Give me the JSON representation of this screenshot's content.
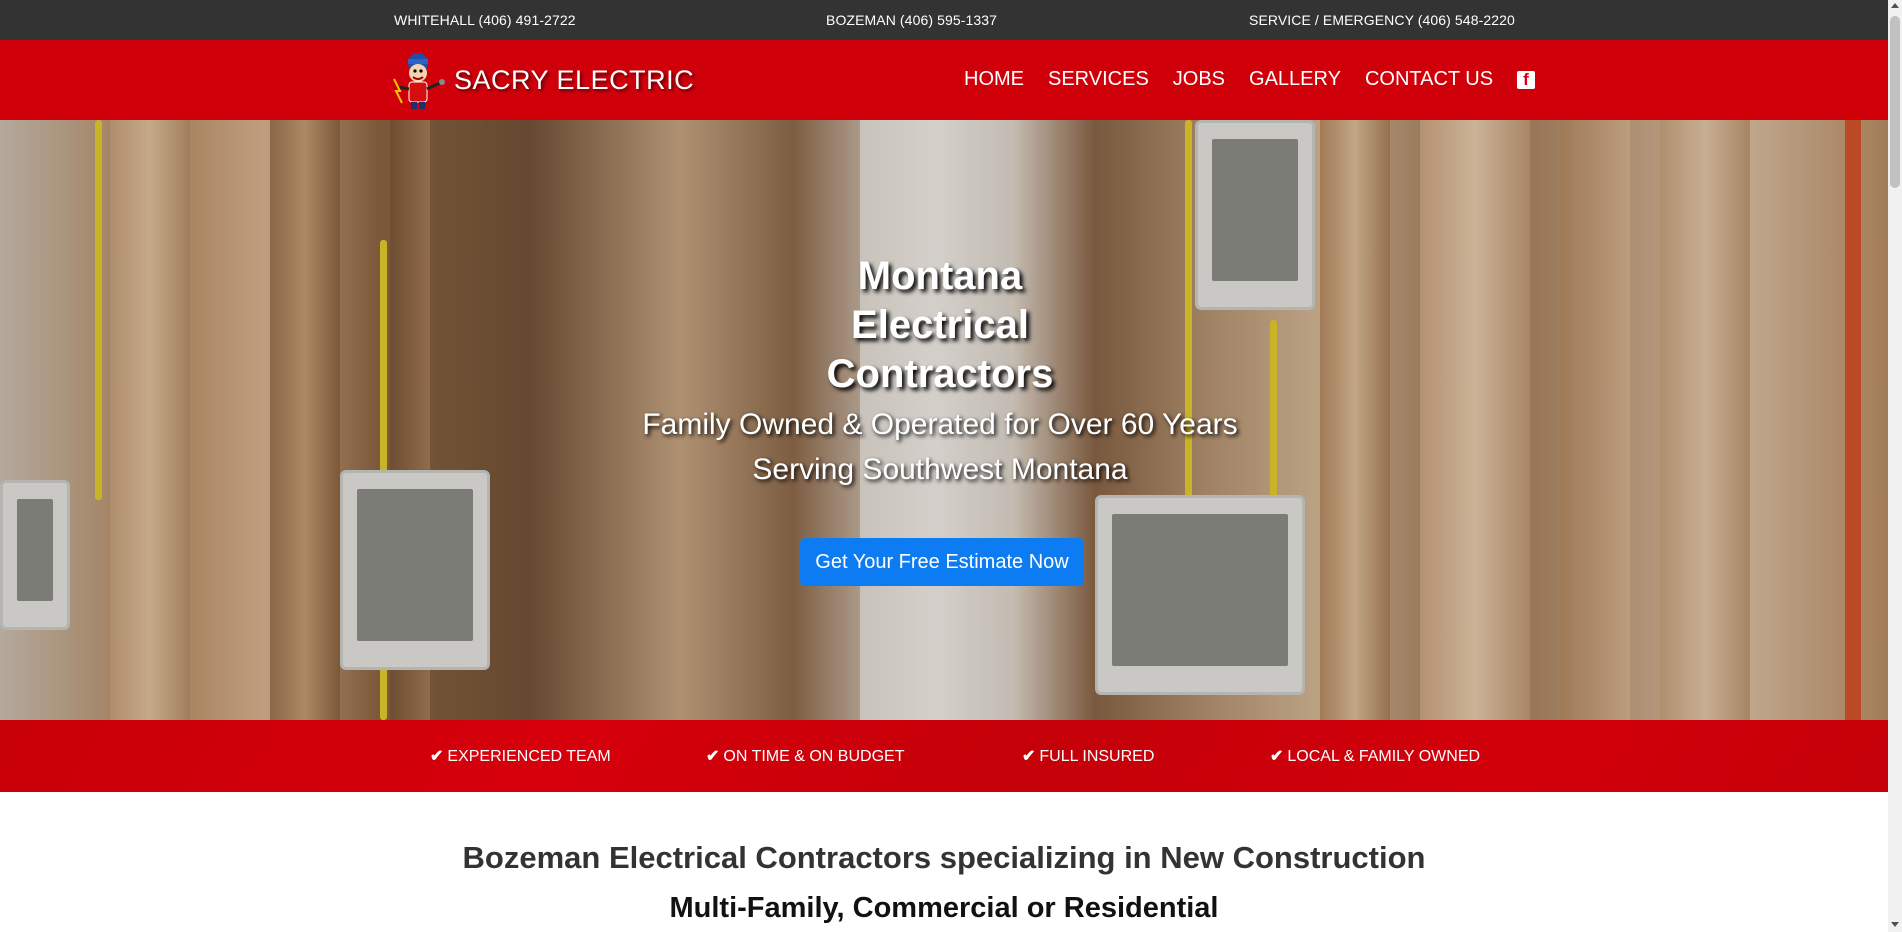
{
  "topbar": {
    "whitehall": "WHITEHALL (406) 491-2722",
    "bozeman": "BOZEMAN (406) 595-1337",
    "emergency": "SERVICE / EMERGENCY (406) 548-2220"
  },
  "brand": {
    "name": "SACRY ELECTRIC",
    "logo_icon": "electrician-mascot-icon"
  },
  "nav": {
    "items": [
      "HOME",
      "SERVICES",
      "JOBS",
      "GALLERY",
      "CONTACT US"
    ],
    "social_icon": "facebook-icon"
  },
  "hero": {
    "title": "Montana Electrical Contractors",
    "subtitle_line1": "Family Owned & Operated for Over 60 Years",
    "subtitle_line2": "Serving Southwest Montana",
    "cta": "Get Your Free Estimate Now"
  },
  "features": {
    "items": [
      "EXPERIENCED TEAM",
      "ON TIME & ON BUDGET",
      "FULL INSURED",
      "LOCAL & FAMILY OWNED"
    ],
    "icon": "checkmark-icon"
  },
  "intro": {
    "title": "Bozeman Electrical Contractors specializing in New Construction",
    "subtitle": "Multi-Family, Commercial or Residential"
  },
  "colors": {
    "topbar": "#333333",
    "brand_red": "#d0000b",
    "cta_blue": "#0d7bf2"
  }
}
